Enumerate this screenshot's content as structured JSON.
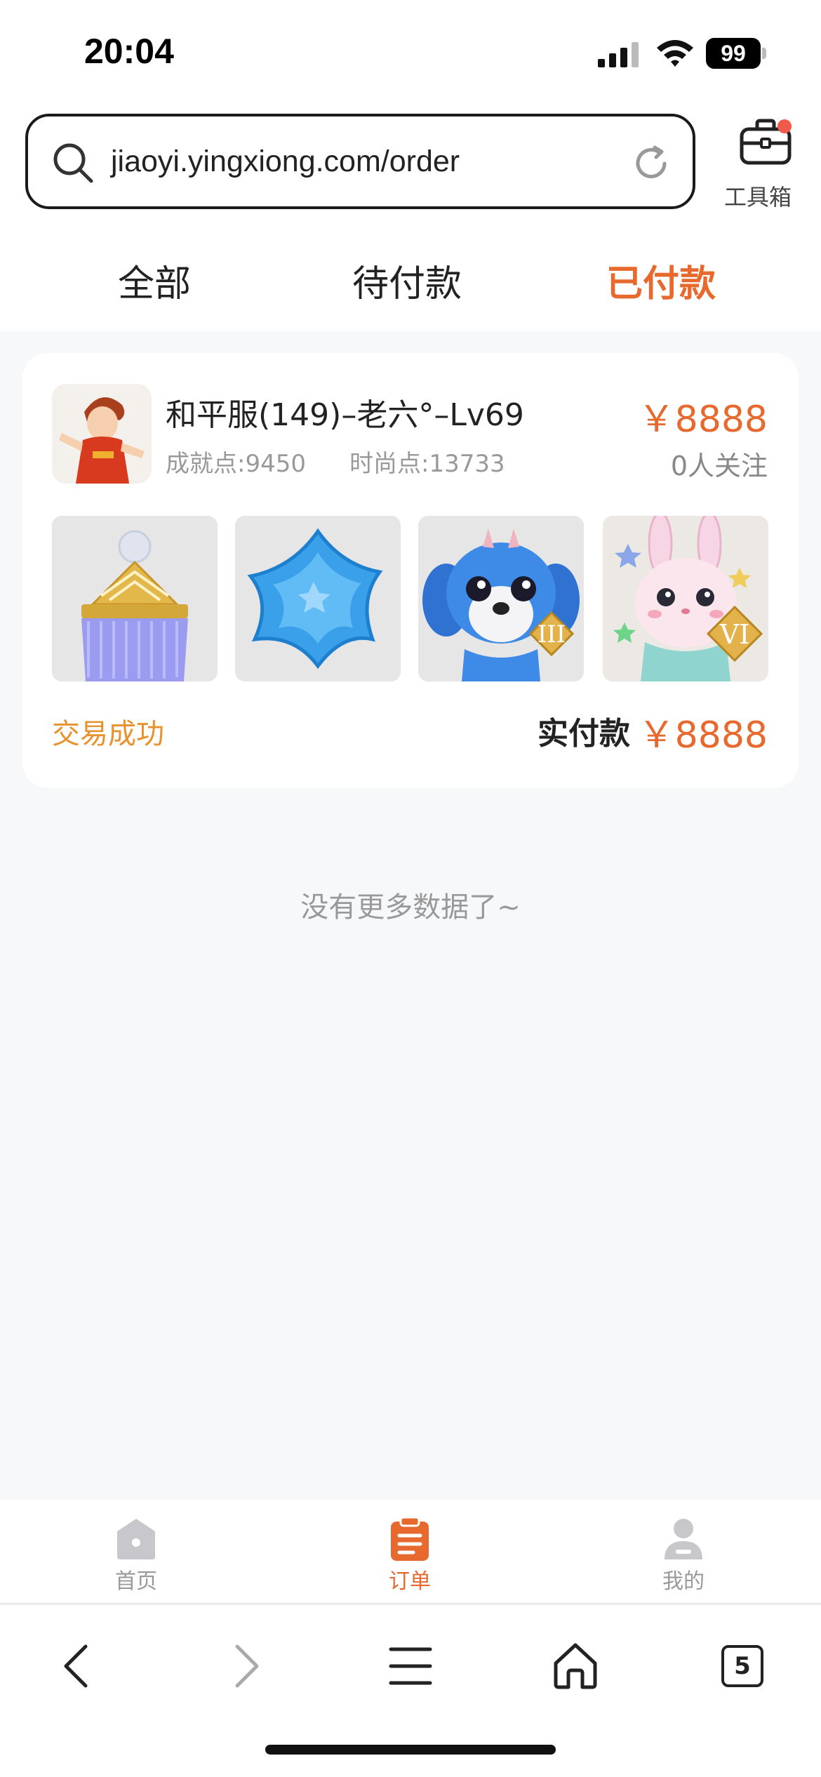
{
  "status_bar": {
    "time": "20:04",
    "battery": "99"
  },
  "browser": {
    "url": "jiaoyi.yingxiong.com/order",
    "toolbox_label": "工具箱",
    "tab_count": "5"
  },
  "tabs": [
    {
      "label": "全部",
      "active": false
    },
    {
      "label": "待付款",
      "active": false
    },
    {
      "label": "已付款",
      "active": true
    }
  ],
  "order": {
    "title": "和平服(149)–老六°–Lv69",
    "achievement": "成就点:9450",
    "fashion": "时尚点:13733",
    "price": "￥8888",
    "followers": "0人关注",
    "items": [
      "crown-item",
      "star-pillow-item",
      "blue-dog-pet",
      "pink-rabbit-pet"
    ],
    "item_badges": [
      "",
      "",
      "III",
      "VI"
    ],
    "status": "交易成功",
    "paid_label": "实付款",
    "paid_amount": "￥8888"
  },
  "empty_text": "没有更多数据了~",
  "bottom_nav": [
    {
      "label": "首页",
      "active": false
    },
    {
      "label": "订单",
      "active": true
    },
    {
      "label": "我的",
      "active": false
    }
  ],
  "colors": {
    "accent": "#e8692e",
    "success": "#e8922e",
    "muted": "#999999"
  }
}
